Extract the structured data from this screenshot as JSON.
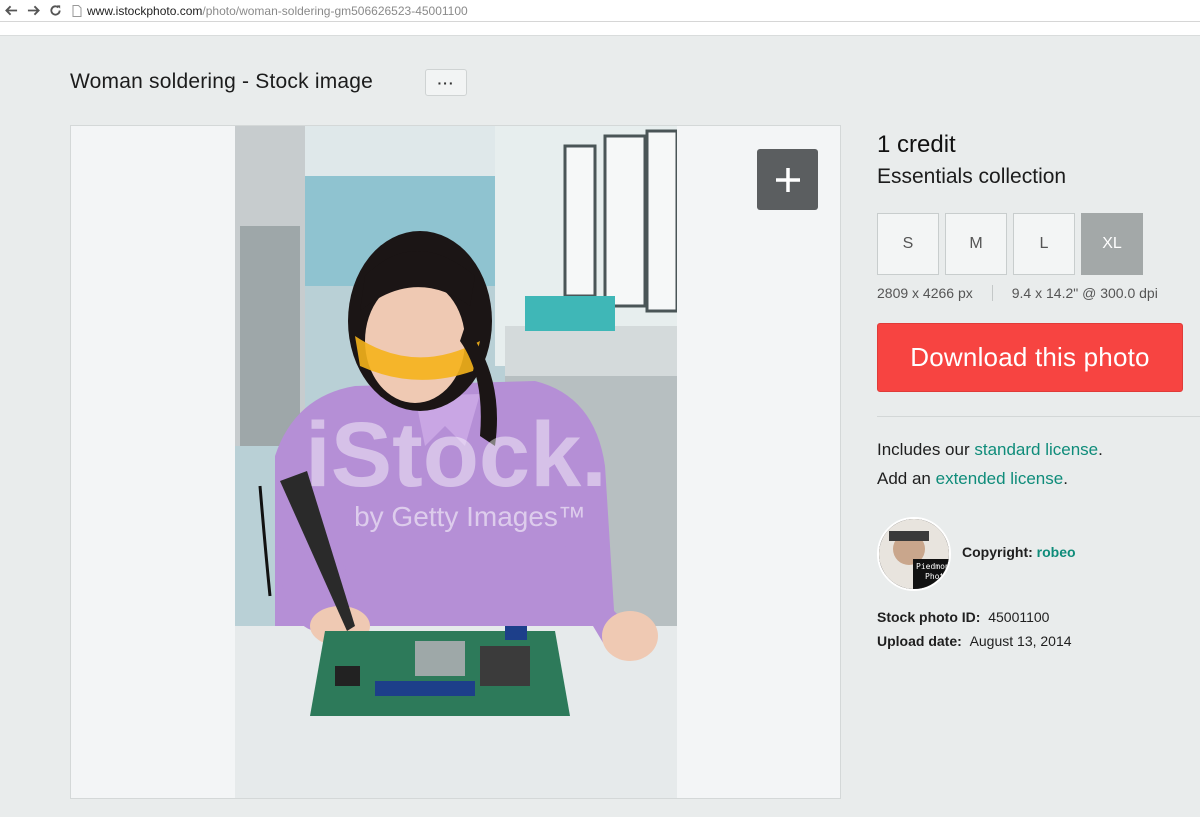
{
  "browser": {
    "url_host": "www.istockphoto.com",
    "url_path": "/photo/woman-soldering-gm506626523-45001100"
  },
  "page": {
    "title": "Woman soldering - Stock image",
    "more_label": "···"
  },
  "photo": {
    "watermark": "iStock.",
    "watermark_sub": "by Getty Images™",
    "add_icon": "plus-icon"
  },
  "purchase": {
    "price": "1 credit",
    "collection": "Essentials collection",
    "sizes": [
      "S",
      "M",
      "L",
      "XL"
    ],
    "selected_size": "XL",
    "pixel_dims": "2809 x 4266 px",
    "print_dims": "9.4 x 14.2\" @ 300.0 dpi",
    "download_label": "Download this photo"
  },
  "license": {
    "line1_prefix": "Includes our ",
    "line1_link": "standard license",
    "line1_suffix": ".",
    "line2_prefix": "Add an ",
    "line2_link": "extended license",
    "line2_suffix": "."
  },
  "contributor": {
    "copyright_label": "Copyright:",
    "name": "robeo",
    "avatar_text": "Piedmont Photo"
  },
  "details": {
    "id_label": "Stock photo ID:",
    "id_value": "45001100",
    "date_label": "Upload date:",
    "date_value": "August 13, 2014"
  },
  "colors": {
    "accent_link": "#0f8c7a",
    "download": "#f74441",
    "background": "#e9ecec"
  }
}
